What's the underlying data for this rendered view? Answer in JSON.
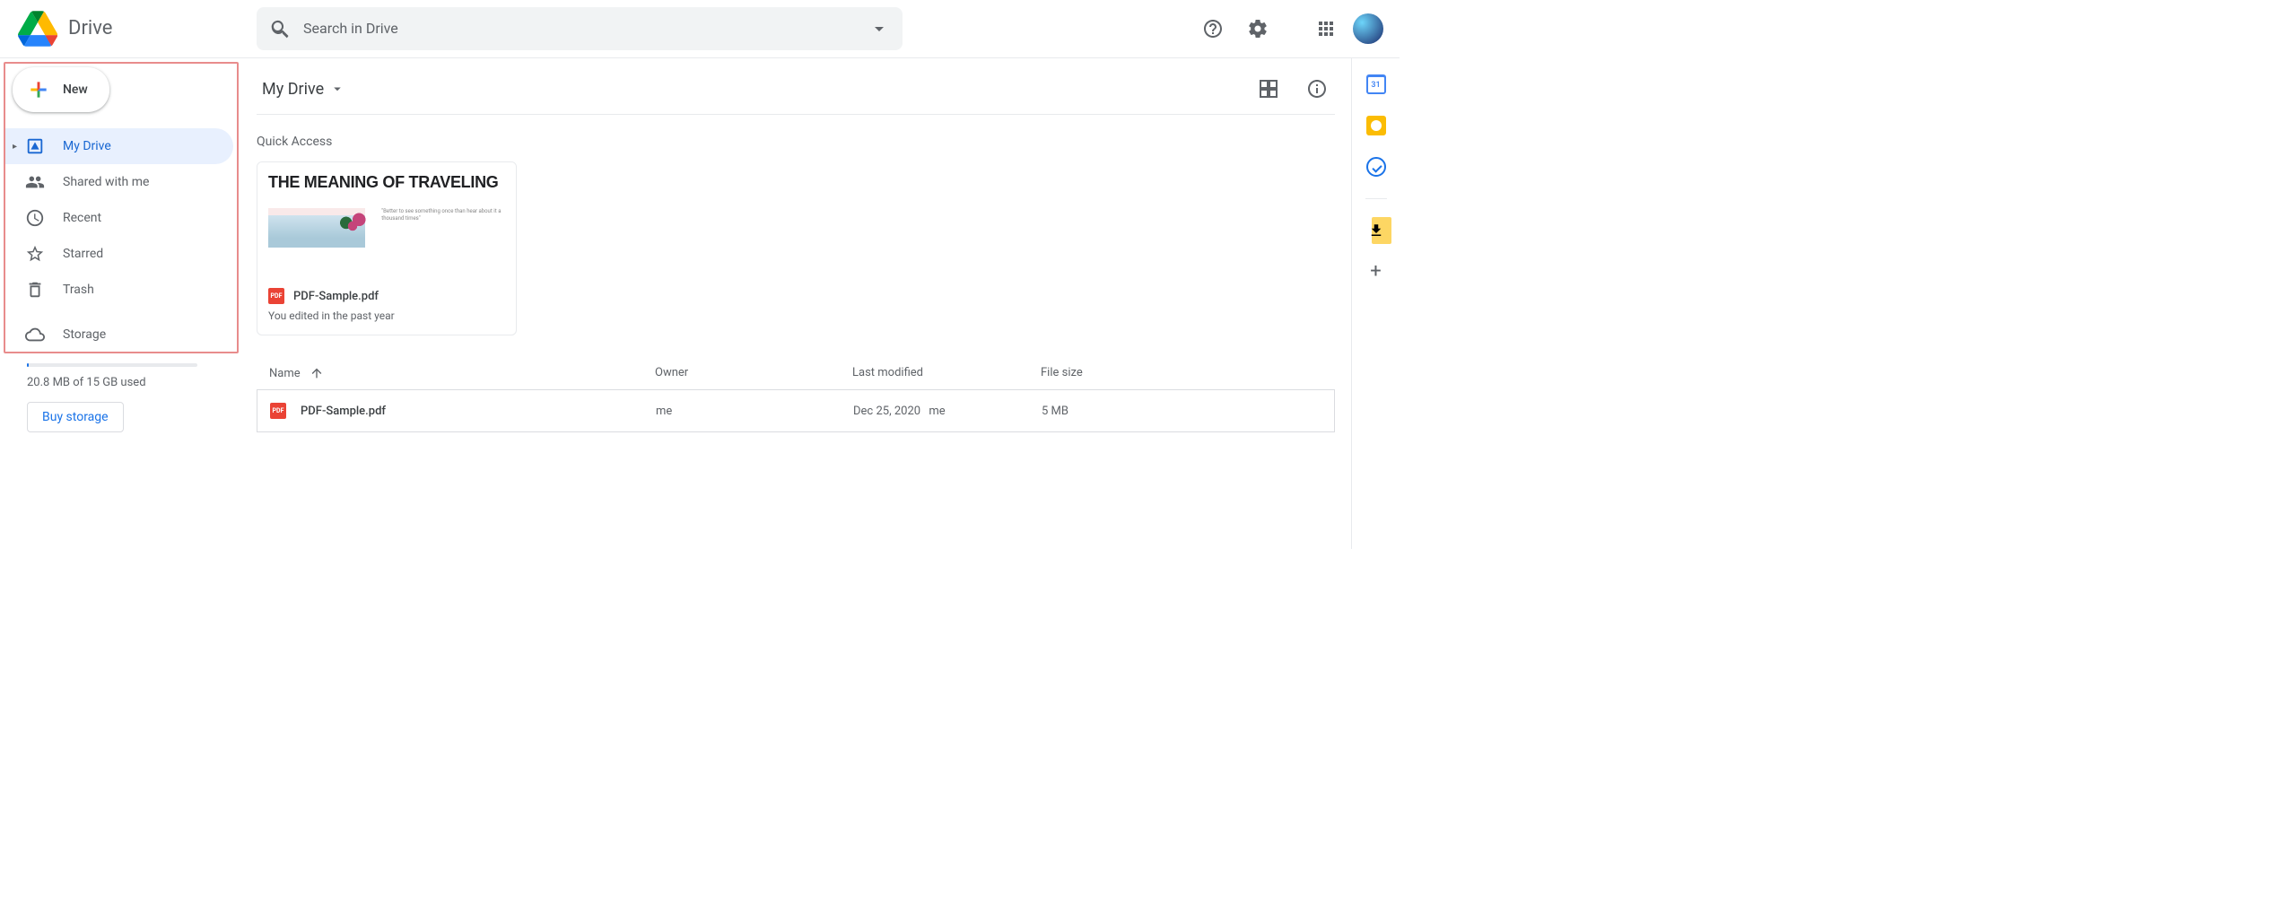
{
  "app": {
    "name": "Drive"
  },
  "search": {
    "placeholder": "Search in Drive"
  },
  "sidebar": {
    "new_label": "New",
    "items": [
      {
        "label": "My Drive"
      },
      {
        "label": "Shared with me"
      },
      {
        "label": "Recent"
      },
      {
        "label": "Starred"
      },
      {
        "label": "Trash"
      }
    ],
    "storage_label": "Storage",
    "storage_used": "20.8 MB of 15 GB used",
    "buy_label": "Buy storage"
  },
  "main": {
    "breadcrumb": "My Drive",
    "quick_access_label": "Quick Access",
    "qa_card": {
      "thumb_heading": "THE MEANING OF TRAVELING",
      "thumb_quote": "\"Better to see something once than hear about it a thousand times\"",
      "file_name": "PDF-Sample.pdf",
      "subtitle": "You edited in the past year",
      "badge": "PDF"
    },
    "columns": {
      "name": "Name",
      "owner": "Owner",
      "modified": "Last modified",
      "size": "File size"
    },
    "rows": [
      {
        "badge": "PDF",
        "name": "PDF-Sample.pdf",
        "owner": "me",
        "modified_date": "Dec 25, 2020",
        "modified_by": "me",
        "size": "5 MB"
      }
    ]
  }
}
